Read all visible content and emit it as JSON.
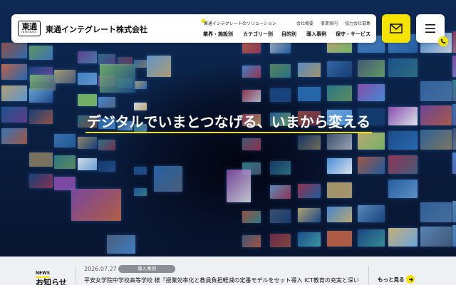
{
  "header": {
    "logo_kanji": "東通",
    "logo_sub": "INTEGRATE",
    "company_name": "東通インテグレート株式会社",
    "solution_link": "東通インテグレートのソリューション",
    "utility_links": [
      "会社概要",
      "事業案内",
      "協力会社募集"
    ],
    "nav_items": [
      "業界・施設別",
      "カテゴリー別",
      "目的別",
      "導入事例",
      "保守・サービス"
    ]
  },
  "buttons": {
    "mail_icon": "envelope-icon",
    "menu_icon": "hamburger-icon",
    "phone_icon": "phone-icon"
  },
  "hero": {
    "catchphrase": "デジタルでいまとつなげる、いまから変える"
  },
  "news": {
    "label_en": "NEWS",
    "label_ja": "お知らせ",
    "date": "2026.07.27",
    "category": "導入事例",
    "title": "平安女学院中学校高等学校 様「授業効率化と教員負担軽減の定番モデルをセット導入 ICT教育の充実と深い",
    "more_label": "もっと見る",
    "more_icon": "arrow-right-icon"
  },
  "colors": {
    "accent": "#f5e400",
    "hero_dark": "#0a1f42",
    "news_bg": "#eef0f3"
  }
}
